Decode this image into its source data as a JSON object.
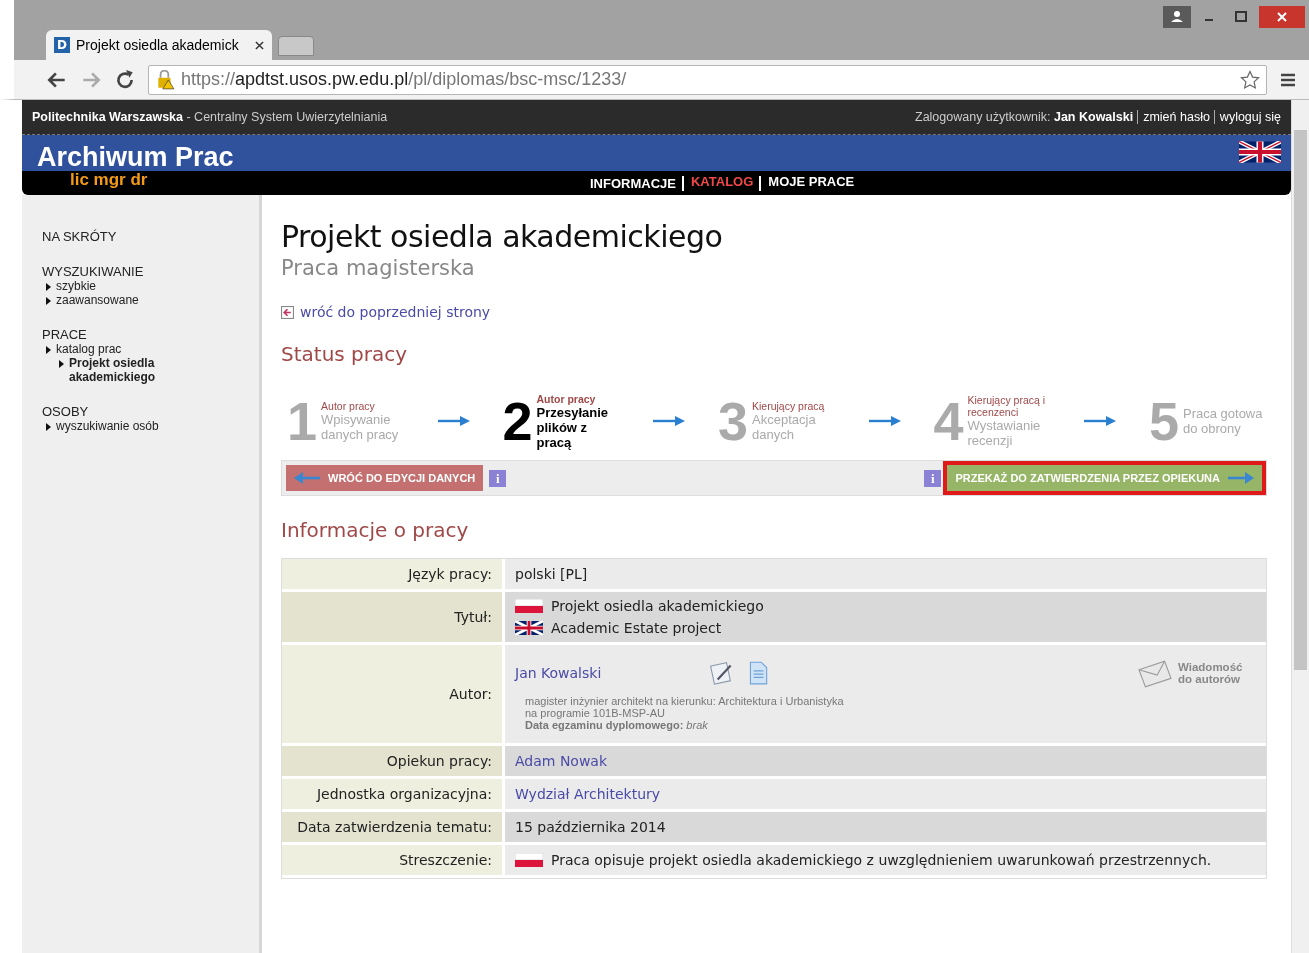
{
  "browser": {
    "tab_title": "Projekt osiedla akademick",
    "tab_favicon": "D",
    "url_scheme": "https://",
    "url_host": "apdtst.usos.pw.edu.pl",
    "url_path": "/pl/diplomas/bsc-msc/1233/"
  },
  "header": {
    "institution": "Politechnika Warszawska",
    "system": "- Centralny System Uwierzytelniania",
    "logged_label": "Zalogowany użytkownik:",
    "user": "Jan Kowalski",
    "links": [
      "zmień hasło",
      "wyloguj się"
    ]
  },
  "banner": {
    "title": "Archiwum Prac",
    "subtitle": "lic mgr dr",
    "nav": [
      {
        "label": "INFORMACJE",
        "selected": false
      },
      {
        "label": "KATALOG",
        "selected": true
      },
      {
        "label": "MOJE PRACE",
        "selected": false
      }
    ]
  },
  "sidebar": [
    {
      "heading": "NA SKRÓTY"
    },
    {
      "heading": "WYSZUKIWANIE",
      "items": [
        {
          "label": "szybkie"
        },
        {
          "label": "zaawansowane"
        }
      ]
    },
    {
      "heading": "PRACE",
      "items": [
        {
          "label": "katalog prac",
          "children": [
            {
              "label": "Projekt osiedla akademickiego"
            }
          ]
        }
      ]
    },
    {
      "heading": "OSOBY",
      "items": [
        {
          "label": "wyszukiwanie osób"
        }
      ]
    }
  ],
  "main": {
    "title": "Projekt osiedla akademickiego",
    "subtitle": "Praca magisterska",
    "back_link": "wróć do poprzedniej strony",
    "status_heading": "Status pracy",
    "steps": [
      {
        "number": "1",
        "role": "Autor pracy",
        "label": "Wpisywanie danych pracy",
        "current": false
      },
      {
        "number": "2",
        "role": "Autor pracy",
        "label": "Przesyłanie plików z pracą",
        "current": true
      },
      {
        "number": "3",
        "role": "Kierujący pracą",
        "label": "Akceptacja danych",
        "current": false
      },
      {
        "number": "4",
        "role": "Kierujący pracą i recenzenci",
        "label": "Wystawianie recenzji",
        "current": false
      },
      {
        "number": "5",
        "label": "Praca gotowa do obrony",
        "current": false
      }
    ],
    "back_button": "WRÓĆ DO EDYCJI DANYCH",
    "back_info": "i",
    "forward_info": "i",
    "forward_button": {
      "label": "PRZEKAŻ DO ZATWIERDZENIA PRZEZ OPIEKUNA",
      "highlighted": true
    },
    "info_heading": "Informacje o pracy",
    "rows": [
      {
        "kind": "text",
        "label": "Język pracy:",
        "value": "polski [PL]"
      },
      {
        "kind": "lang",
        "label": "Tytuł:",
        "lines": [
          {
            "kind": "polish",
            "text": "Projekt osiedla akademickiego"
          },
          {
            "kind": "english",
            "text": "Academic Estate project"
          }
        ]
      },
      {
        "kind": "author",
        "label": "Autor:",
        "name": "Jan Kowalski",
        "details": [
          "magister inżynier architekt na kierunku: Architektura i Urbanistyka",
          "na programie 101B-MSP-AU",
          "**Data egzaminu dyplomowego:** *brak*"
        ],
        "message": "Wiadomość do autorów"
      },
      {
        "kind": "link",
        "label": "Opiekun pracy:",
        "value": "Adam Nowak"
      },
      {
        "kind": "link",
        "label": "Jednostka organizacyjna:",
        "value": "Wydział Architektury"
      },
      {
        "kind": "text",
        "label": "Data zatwierdzenia tematu:",
        "value": "15 października 2014"
      },
      {
        "kind": "lang",
        "label": "Streszczenie:",
        "lines": [
          {
            "kind": "polish",
            "text": "Praca opisuje projekt osiedla akademickiego z uwzględnieniem uwarunkowań przestrzennych."
          }
        ]
      }
    ]
  }
}
